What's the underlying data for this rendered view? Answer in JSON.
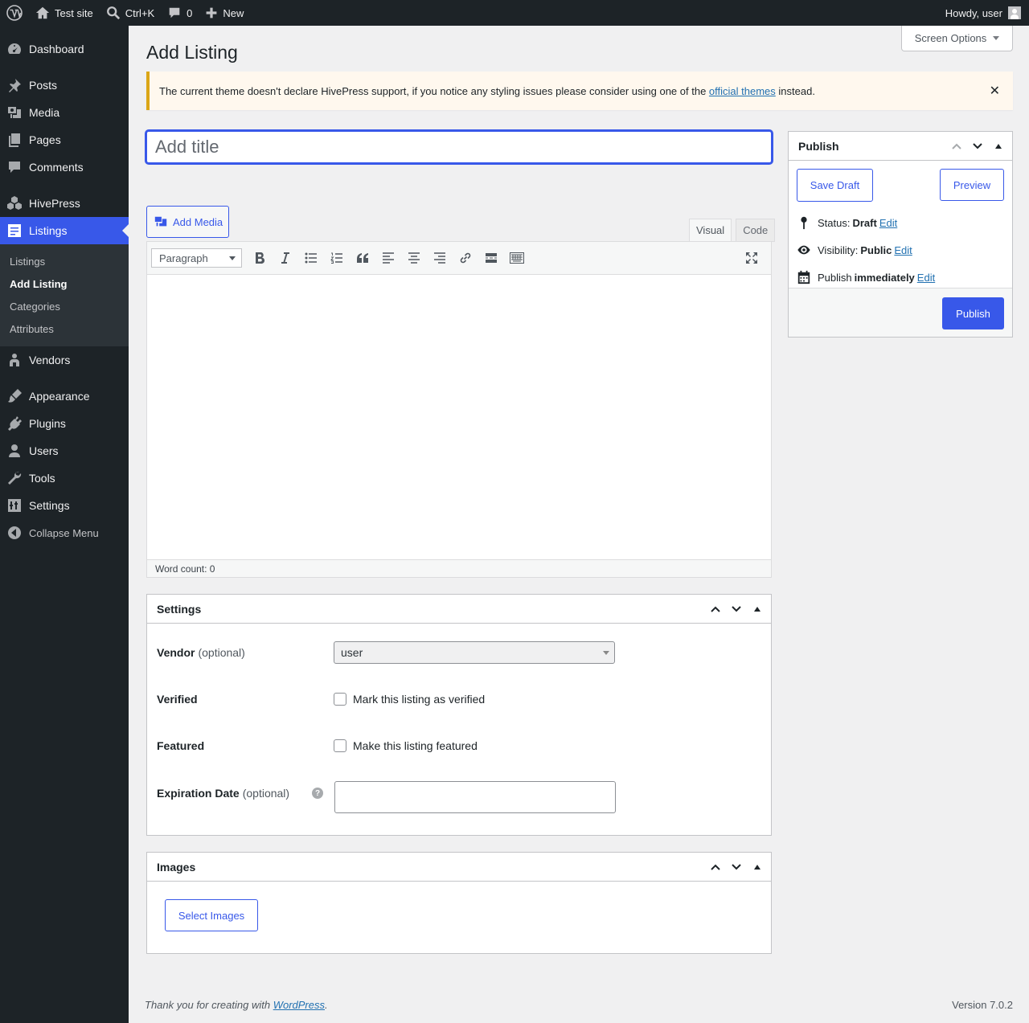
{
  "adminbar": {
    "site_name": "Test site",
    "search_shortcut": "Ctrl+K",
    "comments_count": "0",
    "new_label": "New",
    "howdy": "Howdy, user"
  },
  "sidebar": {
    "items": [
      {
        "label": "Dashboard",
        "icon": "dashboard-icon"
      },
      {
        "label": "Posts",
        "icon": "pin-icon"
      },
      {
        "label": "Media",
        "icon": "media-icon"
      },
      {
        "label": "Pages",
        "icon": "pages-icon"
      },
      {
        "label": "Comments",
        "icon": "comment-icon"
      },
      {
        "label": "HivePress",
        "icon": "hivepress-icon"
      },
      {
        "label": "Listings",
        "icon": "listings-icon"
      },
      {
        "label": "Vendors",
        "icon": "vendors-icon"
      },
      {
        "label": "Appearance",
        "icon": "brush-icon"
      },
      {
        "label": "Plugins",
        "icon": "plug-icon"
      },
      {
        "label": "Users",
        "icon": "user-icon"
      },
      {
        "label": "Tools",
        "icon": "wrench-icon"
      },
      {
        "label": "Settings",
        "icon": "sliders-icon"
      }
    ],
    "listings_submenu": [
      "Listings",
      "Add Listing",
      "Categories",
      "Attributes"
    ],
    "collapse_label": "Collapse Menu"
  },
  "screen_options": "Screen Options",
  "page_title": "Add Listing",
  "notice": {
    "text_before": "The current theme doesn't declare HivePress support, if you notice any styling issues please consider using one of the ",
    "link_text": "official themes",
    "text_after": " instead.",
    "dismiss": "✕"
  },
  "title_placeholder": "Add title",
  "editor": {
    "add_media": "Add Media",
    "tab_visual": "Visual",
    "tab_code": "Code",
    "format": "Paragraph",
    "word_count": "Word count: 0"
  },
  "publish": {
    "title": "Publish",
    "save_draft": "Save Draft",
    "preview": "Preview",
    "status_label": "Status:",
    "status_value": "Draft",
    "visibility_label": "Visibility:",
    "visibility_value": "Public",
    "publish_label": "Publish",
    "publish_value": "immediately",
    "edit": "Edit",
    "publish_button": "Publish"
  },
  "settings": {
    "title": "Settings",
    "vendor_label": "Vendor",
    "optional": "(optional)",
    "vendor_value": "user",
    "verified_label": "Verified",
    "verified_text": "Mark this listing as verified",
    "featured_label": "Featured",
    "featured_text": "Make this listing featured",
    "expiration_label": "Expiration Date",
    "help": "?"
  },
  "images": {
    "title": "Images",
    "select_button": "Select Images"
  },
  "footer": {
    "thanks_before": "Thank you for creating with ",
    "thanks_link": "WordPress",
    "thanks_after": ".",
    "version": "Version 7.0.2"
  },
  "colors": {
    "accent": "#3858e9",
    "sidebar_bg": "#1d2327",
    "notice_border": "#dba617"
  }
}
